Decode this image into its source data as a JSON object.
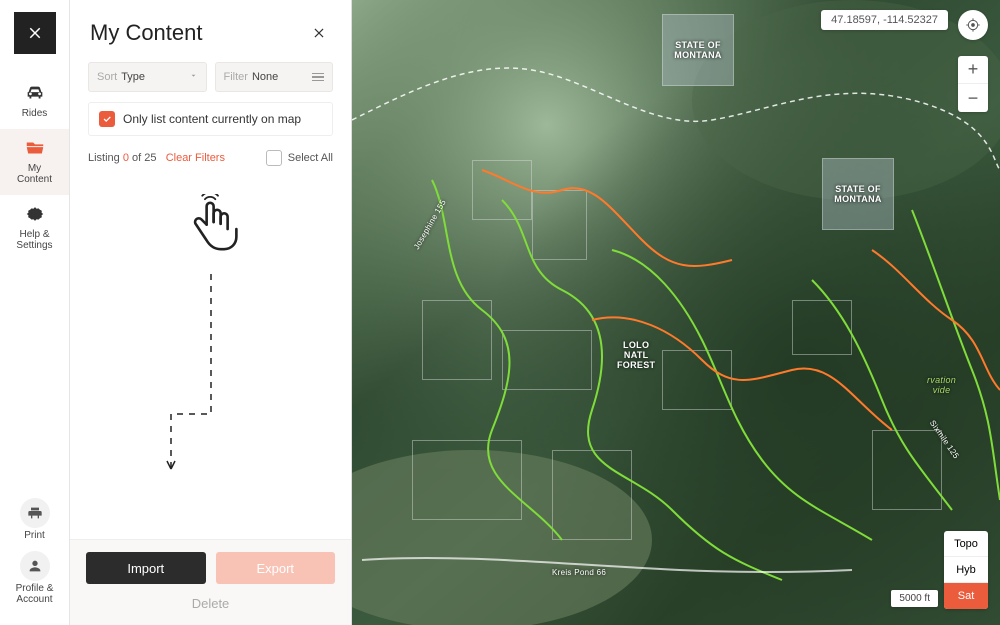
{
  "rail": {
    "items": [
      {
        "label": "Rides"
      },
      {
        "label": "My\nContent"
      },
      {
        "label": "Help &\nSettings"
      }
    ],
    "bottom": {
      "print": "Print",
      "profile": "Profile &\nAccount"
    }
  },
  "panel": {
    "title": "My Content",
    "sort": {
      "prefix": "Sort",
      "value": "Type"
    },
    "filter": {
      "prefix": "Filter",
      "value": "None"
    },
    "onmap_label": "Only list content currently on map",
    "listing": {
      "pre": "Listing ",
      "count": "0",
      "mid": " of 25   ",
      "clear": "Clear Filters"
    },
    "select_all": "Select All",
    "import": "Import",
    "export": "Export",
    "delete": "Delete"
  },
  "map": {
    "coords": "47.18597, -114.52327",
    "layers": {
      "topo": "Topo",
      "hyb": "Hyb",
      "sat": "Sat"
    },
    "scale": "5000 ft",
    "labels": {
      "lolo": "LOLO\nNATL\nFOREST",
      "state": "STATE OF\nMONTANA",
      "josephine": "Josephine 155",
      "kreis": "Kreis Pond 66",
      "sixmile": "Sixmile 125",
      "divide": "rvation\nvide"
    }
  }
}
